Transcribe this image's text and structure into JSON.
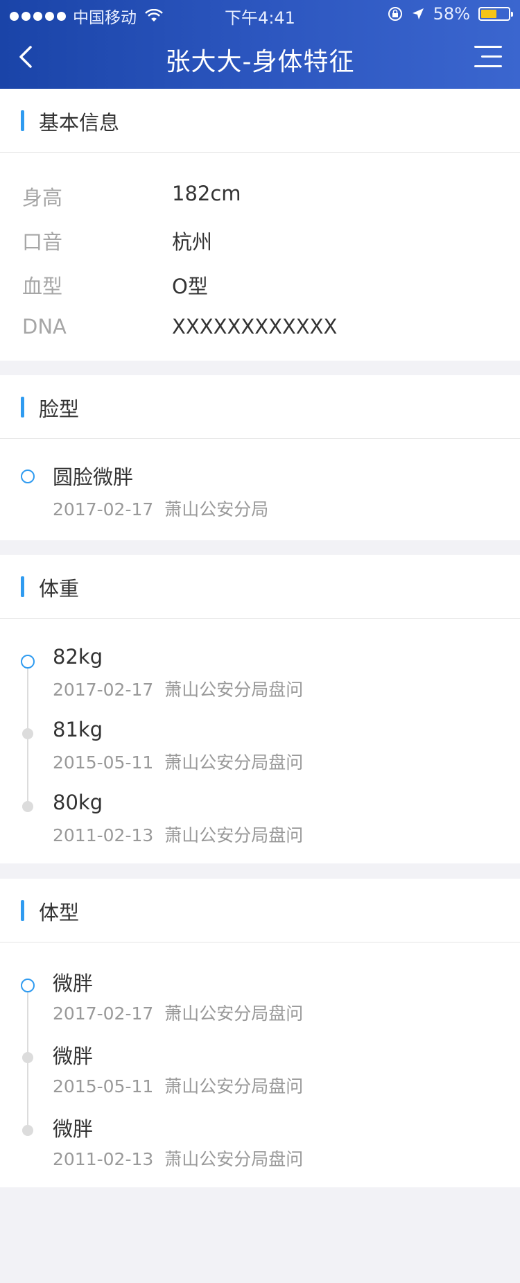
{
  "status_bar": {
    "carrier": "中国移动",
    "time": "下午4:41",
    "battery": "58%",
    "battery_level": 0.58,
    "icons": [
      "signal-dots-icon",
      "wifi-icon",
      "rotation-lock-icon",
      "location-arrow-icon",
      "battery-icon"
    ]
  },
  "nav": {
    "title": "张大大-身体特征",
    "back_icon": "chevron-left-icon",
    "menu_icon": "menu-icon"
  },
  "colors": {
    "header_start": "#1a44a8",
    "header_end": "#3b66cf",
    "accent": "#2f9bf0",
    "battery_fill": "#f5c518"
  },
  "basic_info": {
    "title": "基本信息",
    "rows": [
      {
        "label": "身高",
        "value": "182cm"
      },
      {
        "label": "口音",
        "value": "杭州"
      },
      {
        "label": "血型",
        "value": "O型"
      },
      {
        "label": "DNA",
        "value": "XXXXXXXXXXXX"
      }
    ]
  },
  "face": {
    "title": "脸型",
    "items": [
      {
        "value": "圆脸微胖",
        "date": "2017-02-17",
        "source": "萧山公安分局"
      }
    ]
  },
  "weight": {
    "title": "体重",
    "items": [
      {
        "value": "82kg",
        "date": "2017-02-17",
        "source": "萧山公安分局盘问"
      },
      {
        "value": "81kg",
        "date": "2015-05-11",
        "source": "萧山公安分局盘问"
      },
      {
        "value": "80kg",
        "date": "2011-02-13",
        "source": "萧山公安分局盘问"
      }
    ]
  },
  "body_type": {
    "title": "体型",
    "items": [
      {
        "value": "微胖",
        "date": "2017-02-17",
        "source": "萧山公安分局盘问"
      },
      {
        "value": "微胖",
        "date": "2015-05-11",
        "source": "萧山公安分局盘问"
      },
      {
        "value": "微胖",
        "date": "2011-02-13",
        "source": "萧山公安分局盘问"
      }
    ]
  }
}
